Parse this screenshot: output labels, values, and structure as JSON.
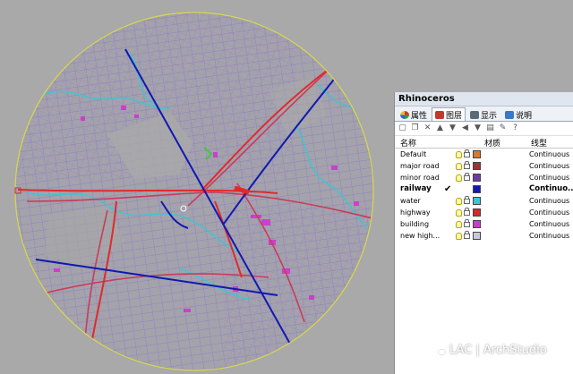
{
  "panel": {
    "title": "Rhinoceros",
    "tabs": [
      {
        "label": "属性",
        "icon": "properties-icon"
      },
      {
        "label": "图层",
        "icon": "layers-icon"
      },
      {
        "label": "显示",
        "icon": "display-icon"
      },
      {
        "label": "说明",
        "icon": "help-icon"
      }
    ],
    "toolbar_icons": [
      "new-layer-icon",
      "new-sublayer-icon",
      "delete-icon",
      "move-up-icon",
      "move-down-icon",
      "move-out-icon",
      "filter-icon",
      "notes-icon",
      "tools-icon",
      "help-icon"
    ],
    "columns": {
      "name": "名称",
      "material": "材质",
      "linetype": "线型"
    },
    "layers": [
      {
        "name": "Default",
        "color": "#d27c2c",
        "linetype": "Continuous",
        "current": false
      },
      {
        "name": "major road",
        "color": "#a0303a",
        "linetype": "Continuous",
        "current": false
      },
      {
        "name": "minor road",
        "color": "#6a3e9e",
        "linetype": "Continuous",
        "current": false
      },
      {
        "name": "railway",
        "color": "#101ca8",
        "linetype": "Continuo...",
        "current": true
      },
      {
        "name": "water",
        "color": "#39c8d2",
        "linetype": "Continuous",
        "current": false
      },
      {
        "name": "highway",
        "color": "#d42a2a",
        "linetype": "Continuous",
        "current": false
      },
      {
        "name": "building",
        "color": "#cc3ccc",
        "linetype": "Continuous",
        "current": false
      },
      {
        "name": "new high...",
        "color": "#c8c8d8",
        "linetype": "Continuous",
        "current": false
      }
    ],
    "current_mark": "✔"
  },
  "watermark": {
    "text": "LAC | ArchStudio"
  },
  "viewport": {
    "background": "#a9a9a9",
    "boundary_color": "#d8d84a",
    "street_color": "#7a5fae",
    "grid_color": "#8b7fc0"
  }
}
